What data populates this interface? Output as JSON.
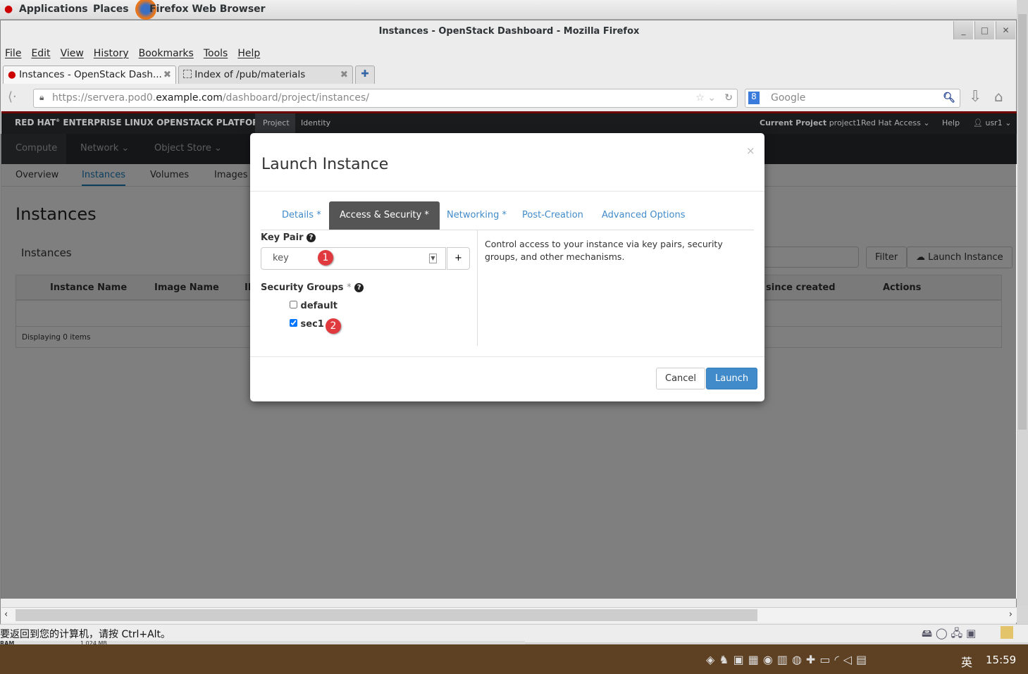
{
  "desktop": {
    "applications": "Applications",
    "places": "Places",
    "active_app": "Firefox Web Browser"
  },
  "window": {
    "title": "Instances - OpenStack Dashboard - Mozilla Firefox"
  },
  "menu": [
    "File",
    "Edit",
    "View",
    "History",
    "Bookmarks",
    "Tools",
    "Help"
  ],
  "tabs": [
    {
      "label": "Instances - OpenStack Dash..."
    },
    {
      "label": "Index of /pub/materials"
    }
  ],
  "url": {
    "prefix": "https://servera.pod0.",
    "domain": "example.com",
    "path": "/dashboard/project/instances/"
  },
  "search": {
    "placeholder": "Google"
  },
  "header": {
    "brand": "RED HAT",
    "brand_rest": "ENTERPRISE LINUX OPENSTACK PLATFORM",
    "tabs": [
      "Project",
      "Identity"
    ],
    "current_project_label": "Current Project",
    "current_project": "project1",
    "redhat_access": "Red Hat Access",
    "help": "Help",
    "user": "usr1"
  },
  "nav": [
    "Compute",
    "Network",
    "Object Store"
  ],
  "subnav": [
    "Overview",
    "Instances",
    "Volumes",
    "Images"
  ],
  "content": {
    "page_title": "Instances",
    "table_title": "Instances",
    "filter": "Filter",
    "launch": "Launch Instance",
    "columns": [
      "Instance Name",
      "Image Name",
      "IP",
      "since created",
      "Actions"
    ],
    "footer": "Displaying 0 items"
  },
  "modal": {
    "title": "Launch Instance",
    "close": "×",
    "tabs": [
      "Details *",
      "Access & Security *",
      "Networking *",
      "Post-Creation",
      "Advanced Options"
    ],
    "active_tab": 1,
    "key_pair_label": "Key Pair",
    "key_pair_value": "key",
    "add": "+",
    "security_groups_label": "Security Groups",
    "required_mark": "*",
    "groups": [
      {
        "name": "default",
        "checked": false
      },
      {
        "name": "sec1",
        "checked": true
      }
    ],
    "help_text": "Control access to your instance via key pairs, security groups, and other mechanisms.",
    "cancel": "Cancel",
    "launch": "Launch",
    "badges": [
      "1",
      "2"
    ],
    "accent": "#428bca"
  },
  "statusbar": {
    "message": "要返回到您的计算机，请按 Ctrl+Alt。",
    "ram_label": "RAM",
    "ram_value": "1,024 MB"
  },
  "clock": "15:59",
  "ime": "英"
}
